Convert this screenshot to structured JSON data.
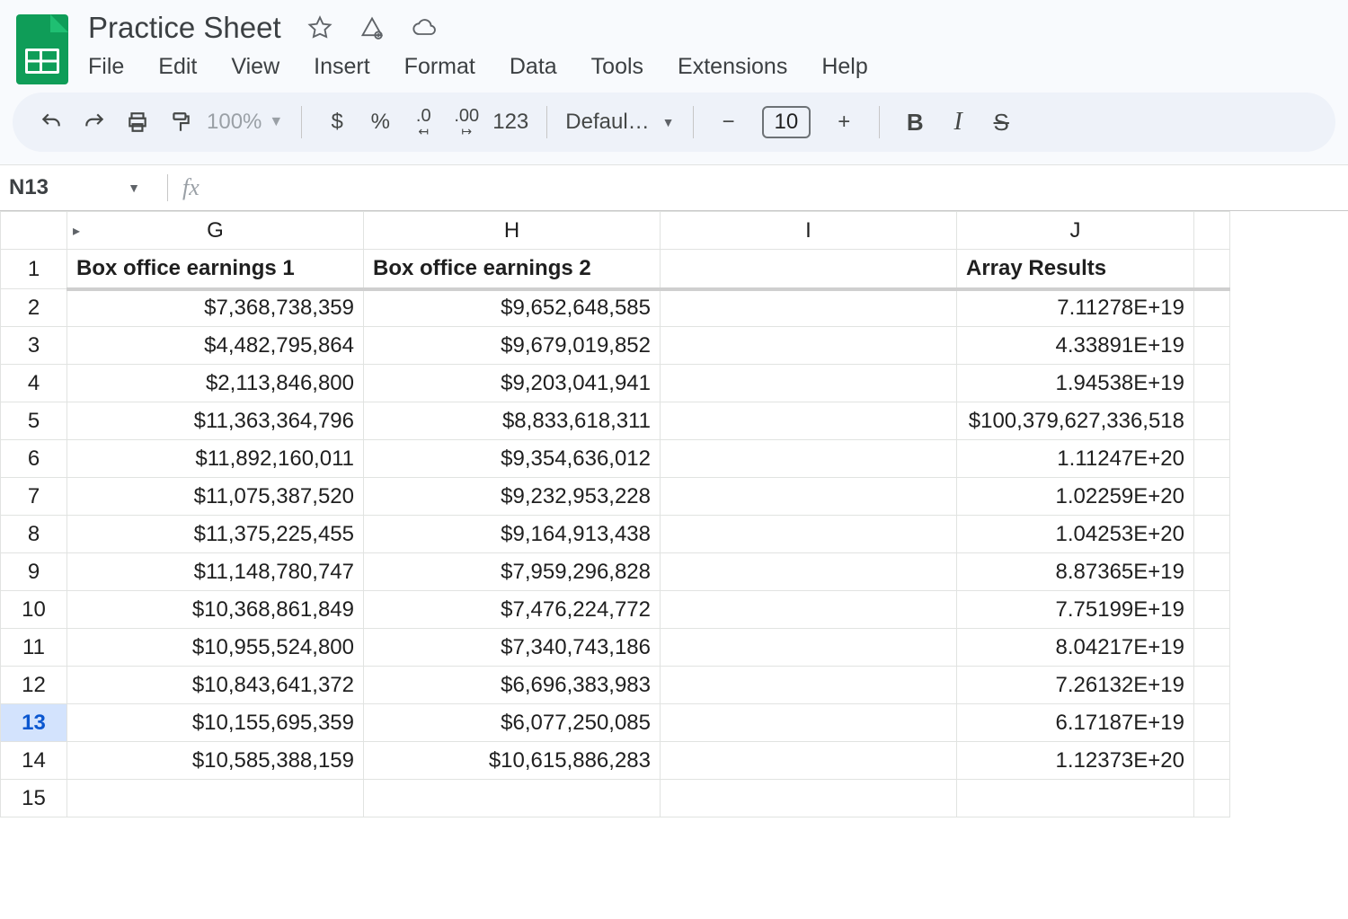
{
  "doc": {
    "title": "Practice Sheet"
  },
  "menu": {
    "file": "File",
    "edit": "Edit",
    "view": "View",
    "insert": "Insert",
    "format": "Format",
    "data": "Data",
    "tools": "Tools",
    "extensions": "Extensions",
    "help": "Help"
  },
  "toolbar": {
    "zoom": "100%",
    "currency": "$",
    "percent": "%",
    "dec_dec": ".0",
    "inc_dec": ".00",
    "num_fmt": "123",
    "font_name": "Defaul…",
    "font_size": "10",
    "minus": "−",
    "plus": "+",
    "bold": "B",
    "italic": "I",
    "strike": "S"
  },
  "namebox": {
    "ref": "N13"
  },
  "fx": {
    "label": "fx"
  },
  "columns": [
    "G",
    "H",
    "I",
    "J",
    ""
  ],
  "headers": {
    "G": "Box office earnings 1",
    "H": "Box office earnings 2",
    "I": "",
    "J": "Array Results"
  },
  "active_row": 13,
  "rows": [
    {
      "n": 2,
      "G": "$7,368,738,359",
      "H": "$9,652,648,585",
      "I": "",
      "J": "7.11278E+19"
    },
    {
      "n": 3,
      "G": "$4,482,795,864",
      "H": "$9,679,019,852",
      "I": "",
      "J": "4.33891E+19"
    },
    {
      "n": 4,
      "G": "$2,113,846,800",
      "H": "$9,203,041,941",
      "I": "",
      "J": "1.94538E+19"
    },
    {
      "n": 5,
      "G": "$11,363,364,796",
      "H": "$8,833,618,311",
      "I": "",
      "J": "$100,379,627,336,518"
    },
    {
      "n": 6,
      "G": "$11,892,160,011",
      "H": "$9,354,636,012",
      "I": "",
      "J": "1.11247E+20"
    },
    {
      "n": 7,
      "G": "$11,075,387,520",
      "H": "$9,232,953,228",
      "I": "",
      "J": "1.02259E+20"
    },
    {
      "n": 8,
      "G": "$11,375,225,455",
      "H": "$9,164,913,438",
      "I": "",
      "J": "1.04253E+20"
    },
    {
      "n": 9,
      "G": "$11,148,780,747",
      "H": "$7,959,296,828",
      "I": "",
      "J": "8.87365E+19"
    },
    {
      "n": 10,
      "G": "$10,368,861,849",
      "H": "$7,476,224,772",
      "I": "",
      "J": "7.75199E+19"
    },
    {
      "n": 11,
      "G": "$10,955,524,800",
      "H": "$7,340,743,186",
      "I": "",
      "J": "8.04217E+19"
    },
    {
      "n": 12,
      "G": "$10,843,641,372",
      "H": "$6,696,383,983",
      "I": "",
      "J": "7.26132E+19"
    },
    {
      "n": 13,
      "G": "$10,155,695,359",
      "H": "$6,077,250,085",
      "I": "",
      "J": "6.17187E+19"
    },
    {
      "n": 14,
      "G": "$10,585,388,159",
      "H": "$10,615,886,283",
      "I": "",
      "J": "1.12373E+20"
    },
    {
      "n": 15,
      "G": "",
      "H": "",
      "I": "",
      "J": ""
    }
  ]
}
